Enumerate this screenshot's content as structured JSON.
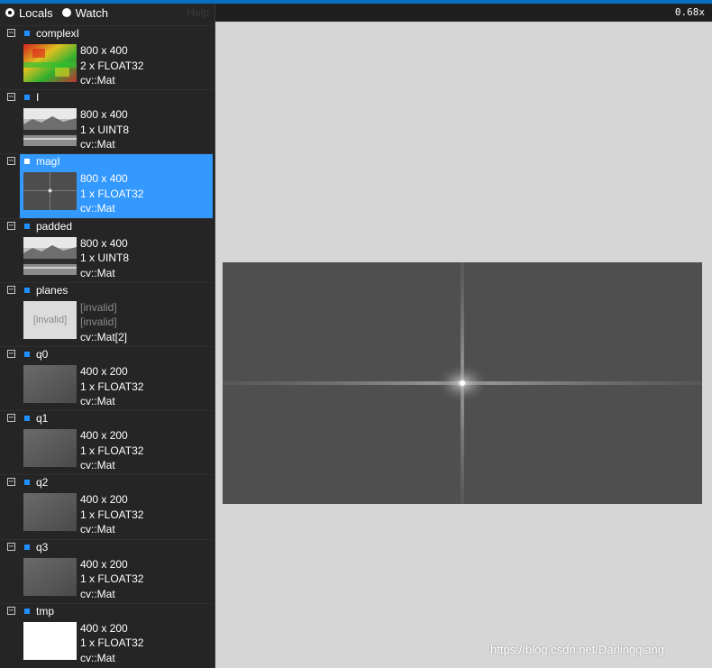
{
  "header": {
    "modes": [
      {
        "label": "Locals",
        "selected": true
      },
      {
        "label": "Watch",
        "selected": false
      }
    ],
    "help": "Help",
    "zoom": "0.68x"
  },
  "variables": [
    {
      "name": "complexI",
      "dims": "800 x 400",
      "type": "2 x FLOAT32",
      "cls": "cv::Mat",
      "thumb": "colorful"
    },
    {
      "name": "I",
      "dims": "800 x 400",
      "type": "1 x UINT8",
      "cls": "cv::Mat",
      "thumb": "landscape"
    },
    {
      "name": "magI",
      "dims": "800 x 400",
      "type": "1 x FLOAT32",
      "cls": "cv::Mat",
      "thumb": "spectrum",
      "selected": true
    },
    {
      "name": "padded",
      "dims": "800 x 400",
      "type": "1 x UINT8",
      "cls": "cv::Mat",
      "thumb": "landscape"
    },
    {
      "name": "planes",
      "dims": "[invalid]",
      "type": "[invalid]",
      "cls": "cv::Mat[2]",
      "thumb": "invalid",
      "thumb_label": "[invalid]"
    },
    {
      "name": "q0",
      "dims": "400 x 200",
      "type": "1 x FLOAT32",
      "cls": "cv::Mat",
      "thumb": "gray"
    },
    {
      "name": "q1",
      "dims": "400 x 200",
      "type": "1 x FLOAT32",
      "cls": "cv::Mat",
      "thumb": "gray"
    },
    {
      "name": "q2",
      "dims": "400 x 200",
      "type": "1 x FLOAT32",
      "cls": "cv::Mat",
      "thumb": "gray"
    },
    {
      "name": "q3",
      "dims": "400 x 200",
      "type": "1 x FLOAT32",
      "cls": "cv::Mat",
      "thumb": "gray"
    },
    {
      "name": "tmp",
      "dims": "400 x 200",
      "type": "1 x FLOAT32",
      "cls": "cv::Mat",
      "thumb": "white"
    }
  ],
  "watermark": "https://blog.csdn.net/Darlingqiang"
}
